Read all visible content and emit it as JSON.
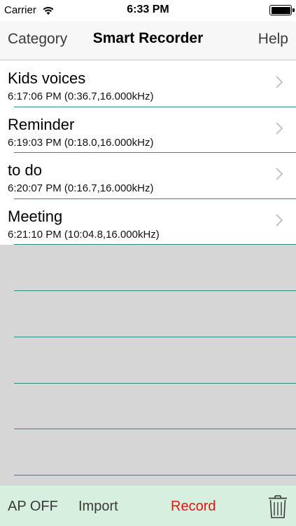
{
  "status": {
    "carrier": "Carrier",
    "time": "6:33 PM"
  },
  "nav": {
    "left": "Category",
    "title": "Smart Recorder",
    "right": "Help"
  },
  "recordings": [
    {
      "title": "Kids voices",
      "subtitle": "6:17:06 PM (0:36.7,16.000kHz)"
    },
    {
      "title": "Reminder",
      "subtitle": "6:19:03 PM (0:18.0,16.000kHz)"
    },
    {
      "title": "to do",
      "subtitle": "6:20:07 PM (0:16.7,16.000kHz)"
    },
    {
      "title": "Meeting",
      "subtitle": "6:21:10 PM (10:04.8,16.000kHz)"
    }
  ],
  "toolbar": {
    "ap_label": "AP OFF",
    "import_label": "Import",
    "record_label": "Record"
  },
  "icons": {
    "wifi": "wifi-icon",
    "battery": "battery-icon",
    "chevron": "chevron-right-icon",
    "trash": "trash-icon"
  },
  "colors": {
    "separator": "#2f8a8c",
    "toolbar_bg": "#d7efdf",
    "record": "#e8140c",
    "empty_bg": "#d6d6d6"
  }
}
